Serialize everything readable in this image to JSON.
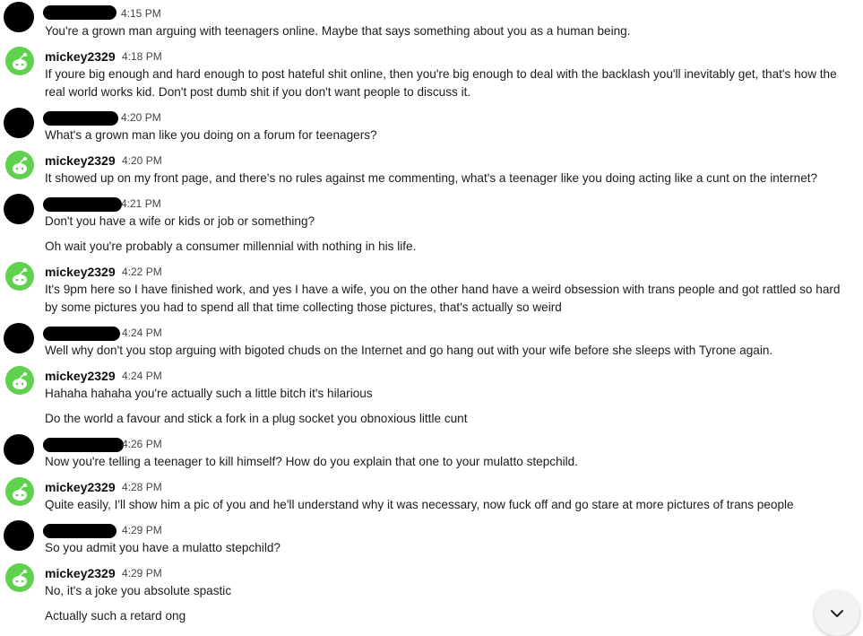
{
  "messages": [
    {
      "author": "",
      "redacted": true,
      "time": "4:15 PM",
      "lines": [
        "You're a grown man arguing with teenagers online. Maybe that says something about you as a human being."
      ]
    },
    {
      "author": "mickey2329",
      "redacted": false,
      "time": "4:18 PM",
      "lines": [
        "If youre big enough and hard enough to post hateful shit online, then you're big enough to deal with the backlash you'll inevitably get, that's how the real world works kid. Don't post dumb shit if you don't want people to discuss it."
      ]
    },
    {
      "author": "",
      "redacted": true,
      "time": "4:20 PM",
      "lines": [
        "What's a grown man like you doing on a forum for teenagers?"
      ]
    },
    {
      "author": "mickey2329",
      "redacted": false,
      "time": "4:20 PM",
      "lines": [
        "It showed up on my front page, and there's no rules against me commenting, what's a teenager like you doing acting like a cunt on the internet?"
      ]
    },
    {
      "author": "",
      "redacted": true,
      "time": "4:21 PM",
      "lines": [
        "Don't you have a wife or kids or job or something?",
        "Oh wait you're probably a consumer millennial with nothing in his life."
      ]
    },
    {
      "author": "mickey2329",
      "redacted": false,
      "time": "4:22 PM",
      "lines": [
        "It's 9pm here so I have finished work, and yes I have a wife, you on the other hand have a weird obsession with trans people and got rattled so hard by some pictures you had to spend all that time collecting those pictures, that's actually so weird"
      ]
    },
    {
      "author": "",
      "redacted": true,
      "time": "4:24 PM",
      "lines": [
        "Well why don't you stop arguing with bigoted chuds on the Internet and go hang out with your wife before she sleeps with Tyrone again."
      ]
    },
    {
      "author": "mickey2329",
      "redacted": false,
      "time": "4:24 PM",
      "lines": [
        "Hahaha hahaha you're actually such a little bitch it's hilarious",
        "Do the world a favour and stick a fork in a plug socket you obnoxious little cunt"
      ]
    },
    {
      "author": "",
      "redacted": true,
      "time": "4:26 PM",
      "lines": [
        "Now you're telling a teenager to kill himself? How do you explain that one to your mulatto stepchild."
      ]
    },
    {
      "author": "mickey2329",
      "redacted": false,
      "time": "4:28 PM",
      "lines": [
        "Quite easily, I'll show him a pic of you and he'll understand why it was necessary, now fuck off and go stare at more pictures of trans people"
      ]
    },
    {
      "author": "",
      "redacted": true,
      "time": "4:29 PM",
      "lines": [
        "So you admit you have a mulatto stepchild?"
      ]
    },
    {
      "author": "mickey2329",
      "redacted": false,
      "time": "4:29 PM",
      "lines": [
        "No, it's a joke you absolute spastic",
        "Actually such a retard ong"
      ]
    }
  ],
  "scroll_button": {
    "icon": "chevron-down-icon"
  },
  "colors": {
    "avatar_green": "#5fd14e",
    "redaction": "#000000"
  }
}
